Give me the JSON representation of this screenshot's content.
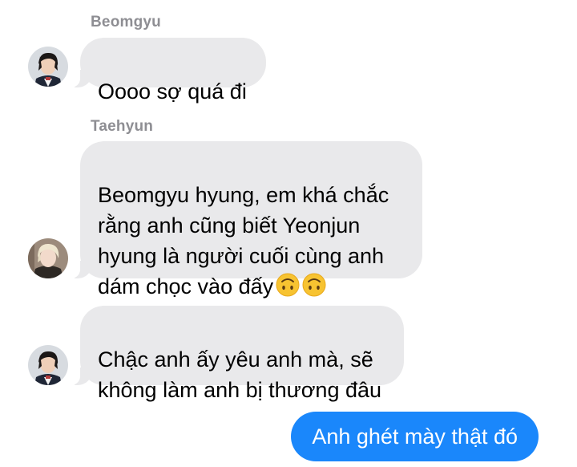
{
  "conversation": {
    "messages": [
      {
        "sender": "Beomgyu",
        "text": "Oooo sợ quá đi"
      },
      {
        "sender": "Taehyun",
        "text": "Beomgyu hyung, em khá chắc\nrằng anh cũng biết Yeonjun\nhyung là người cuối cùng anh\ndám chọc vào đấy",
        "emoji": [
          "upside-down-face-emoji",
          "upside-down-face-emoji"
        ]
      },
      {
        "sender": "Beomgyu",
        "text": "Chậc anh ấy yêu anh mà, sẽ\nkhông làm anh bị thương đâu"
      }
    ],
    "outgoing": {
      "text": "Anh ghét mày thật đó"
    }
  },
  "colors": {
    "incoming_bubble": "#e9e9eb",
    "outgoing_bubble": "#1a87fb",
    "sender_name": "#8e8e93"
  },
  "icons": {
    "avatar_beomgyu": "avatar-beomgyu",
    "avatar_taehyun": "avatar-taehyun"
  }
}
